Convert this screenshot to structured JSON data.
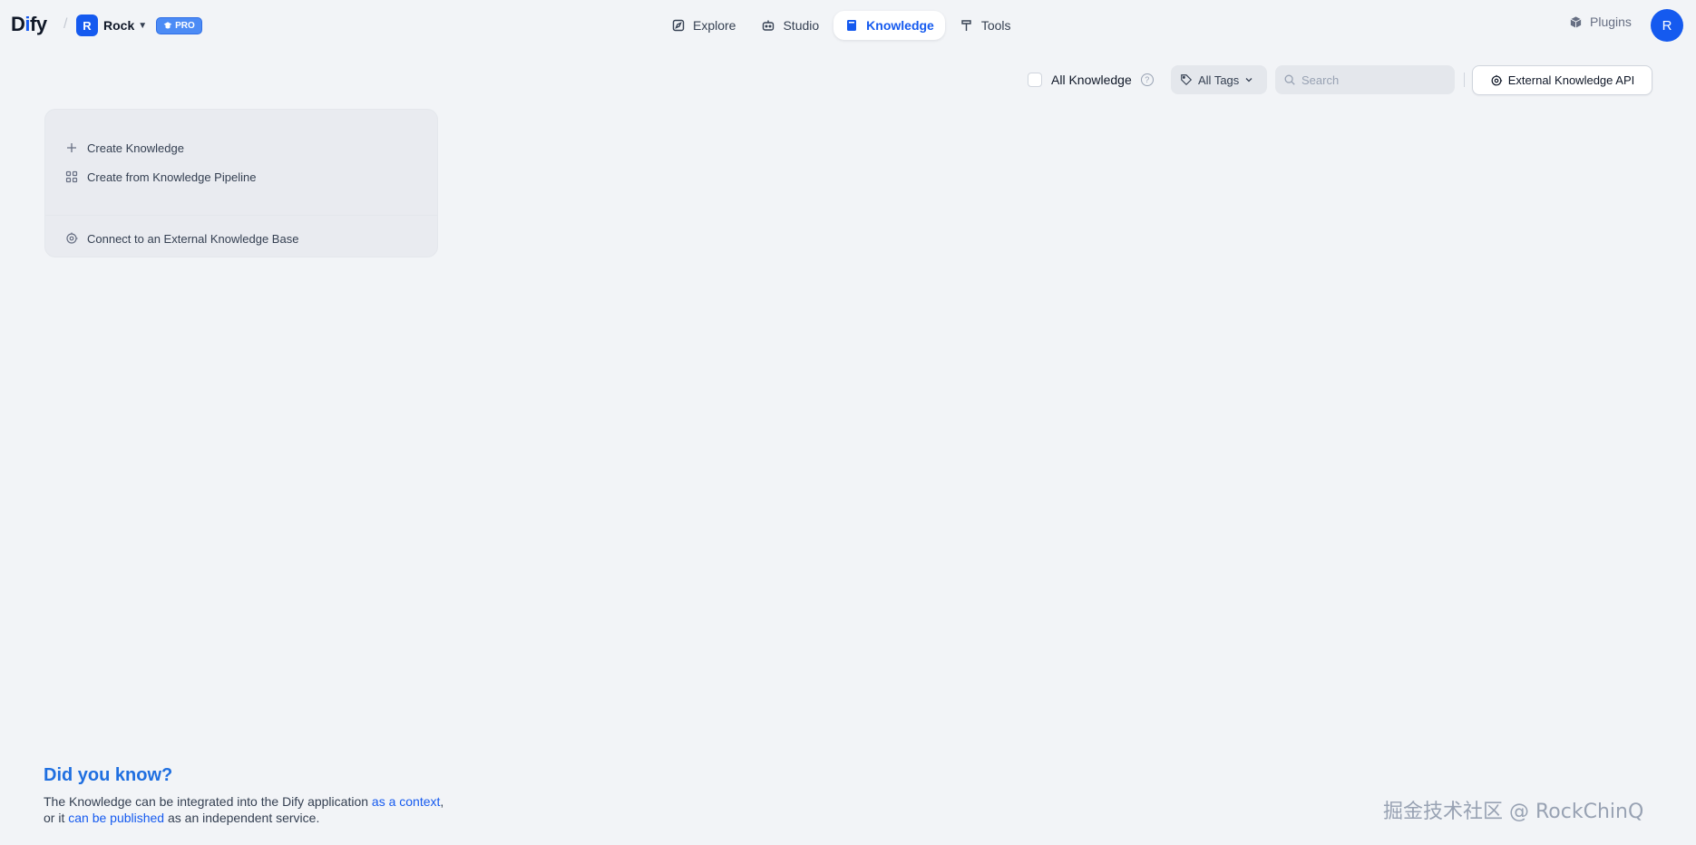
{
  "header": {
    "logo": {
      "part1": "D",
      "part2": "i",
      "part3": "fy"
    },
    "workspace": {
      "initial": "R",
      "name": "Rock",
      "badge": "PRO"
    },
    "nav": [
      {
        "label": "Explore",
        "icon": "compass-icon"
      },
      {
        "label": "Studio",
        "icon": "robot-icon"
      },
      {
        "label": "Knowledge",
        "icon": "book-icon",
        "active": true
      },
      {
        "label": "Tools",
        "icon": "hammer-icon"
      }
    ],
    "plugins_label": "Plugins",
    "user_initial": "R"
  },
  "toolbar": {
    "all_knowledge_label": "All Knowledge",
    "tags_label": "All Tags",
    "search_placeholder": "Search",
    "external_api_label": "External Knowledge API"
  },
  "create_card": {
    "create_knowledge": "Create Knowledge",
    "create_from_pipeline": "Create from Knowledge Pipeline",
    "connect_external": "Connect to an External Knowledge Base"
  },
  "did_you_know": {
    "title": "Did you know?",
    "line1_pre": "The Knowledge can be integrated into the Dify application ",
    "line1_link": "as a context",
    "line1_post": ",",
    "line2_pre": "or it ",
    "line2_link": "can be published",
    "line2_post": " as an independent service."
  },
  "watermark": "掘金技术社区 @ RockChinQ",
  "colors": {
    "accent": "#155aef",
    "background": "#f2f4f7"
  }
}
